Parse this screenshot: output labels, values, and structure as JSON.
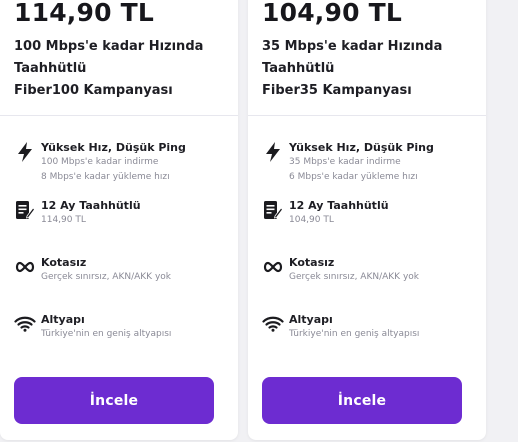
{
  "cards": [
    {
      "price": "114,90 TL",
      "title_lines": [
        "100 Mbps'e kadar Hızında",
        "Taahhütlü",
        "Fiber100 Kampanyası"
      ],
      "features": [
        {
          "icon": "lightning-icon",
          "title": "Yüksek Hız, Düşük Ping",
          "lines": [
            "100 Mbps'e kadar indirme",
            "8 Mbps'e kadar yükleme hızı"
          ]
        },
        {
          "icon": "contract-icon",
          "title": "12 Ay Taahhütlü",
          "lines": [
            "114,90 TL"
          ]
        },
        {
          "icon": "infinity-icon",
          "title": "Kotasız",
          "lines": [
            "Gerçek sınırsız, AKN/AKK yok"
          ]
        },
        {
          "icon": "wifi-icon",
          "title": "Altyapı",
          "lines": [
            "Türkiye'nin en geniş altyapısı"
          ]
        }
      ],
      "button_label": "İncele"
    },
    {
      "price": "104,90 TL",
      "title_lines": [
        "35 Mbps'e kadar Hızında",
        "Taahhütlü",
        "Fiber35 Kampanyası"
      ],
      "features": [
        {
          "icon": "lightning-icon",
          "title": "Yüksek Hız, Düşük Ping",
          "lines": [
            "35 Mbps'e kadar indirme",
            "6 Mbps'e kadar yükleme hızı"
          ]
        },
        {
          "icon": "contract-icon",
          "title": "12 Ay Taahhütlü",
          "lines": [
            "104,90 TL"
          ]
        },
        {
          "icon": "infinity-icon",
          "title": "Kotasız",
          "lines": [
            "Gerçek sınırsız, AKN/AKK yok"
          ]
        },
        {
          "icon": "wifi-icon",
          "title": "Altyapı",
          "lines": [
            "Türkiye'nin en geniş altyapısı"
          ]
        }
      ],
      "button_label": "İncele"
    }
  ],
  "colors": {
    "accent": "#6d2cd1",
    "text": "#1e1e24",
    "muted": "#8a8a96",
    "page_bg": "#f1f1f4"
  }
}
